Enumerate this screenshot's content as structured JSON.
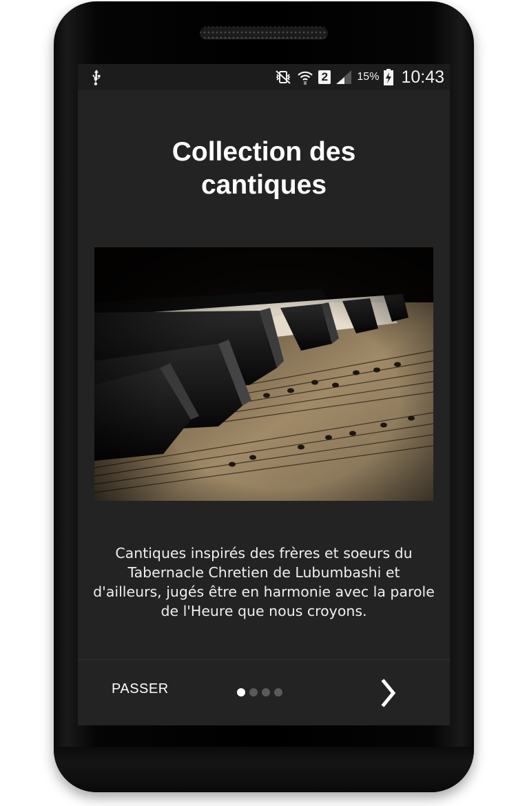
{
  "status_bar": {
    "battery_percent": "15%",
    "time": "10:43",
    "sim_slot": "2",
    "icons": [
      "usb-icon",
      "vibrate-icon",
      "wifi-icon",
      "sim-2-badge",
      "signal-icon",
      "battery-charging-icon"
    ]
  },
  "intro": {
    "title": "Collection des cantiques",
    "hero_image": "piano-sheet-music-image",
    "description": "Cantiques inspirés des frères et soeurs du Tabernacle Chretien de Lubumbashi et d'ailleurs, jugés être en harmonie avec la parole de l'Heure que nous croyons."
  },
  "footer": {
    "skip_label": "PASSER",
    "page_count": 4,
    "current_page": 1,
    "next_icon": "chevron-right-icon"
  },
  "colors": {
    "background": "#232323",
    "status_bar": "#1c1c1c",
    "text": "#ffffff",
    "dot_active": "#ffffff",
    "dot_inactive": "#5a5a5a"
  }
}
